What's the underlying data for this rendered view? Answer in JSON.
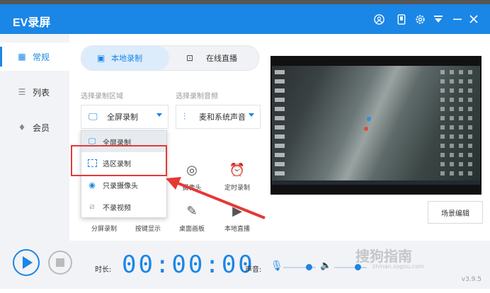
{
  "window": {
    "title": "EV录屏"
  },
  "sidebar": {
    "items": [
      {
        "label": "常规",
        "icon": "grid-icon"
      },
      {
        "label": "列表",
        "icon": "list-icon"
      },
      {
        "label": "会员",
        "icon": "diamond-icon"
      }
    ]
  },
  "tabs": [
    {
      "label": "本地录制"
    },
    {
      "label": "在线直播"
    }
  ],
  "record_area": {
    "label": "选择录制区域",
    "selected": "全屏录制"
  },
  "record_audio": {
    "label": "选择录制音频",
    "selected": "麦和系统声音"
  },
  "area_menu": {
    "items": [
      {
        "label": "全屏录制"
      },
      {
        "label": "选区录制"
      },
      {
        "label": "只录摄像头"
      },
      {
        "label": "不录视频"
      }
    ]
  },
  "tools": {
    "row1": [
      {
        "label": "摄像头"
      },
      {
        "label": "定时录制"
      }
    ],
    "row2": [
      {
        "label": "分屏录制"
      },
      {
        "label": "按键显示"
      },
      {
        "label": "桌面画板"
      },
      {
        "label": "本地直播"
      }
    ]
  },
  "scene_edit": "场景编辑",
  "bottom": {
    "duration_label": "时长:",
    "timer": "00:00:00",
    "volume_label": "声音:",
    "mic_level": 0.78,
    "speaker_level": 0.72
  },
  "version": "v3.9.5",
  "watermark": {
    "text": "搜狗指南",
    "sub": "zhinan.sogou.com"
  },
  "colors": {
    "accent": "#1a86e6",
    "highlight": "#e53935"
  }
}
